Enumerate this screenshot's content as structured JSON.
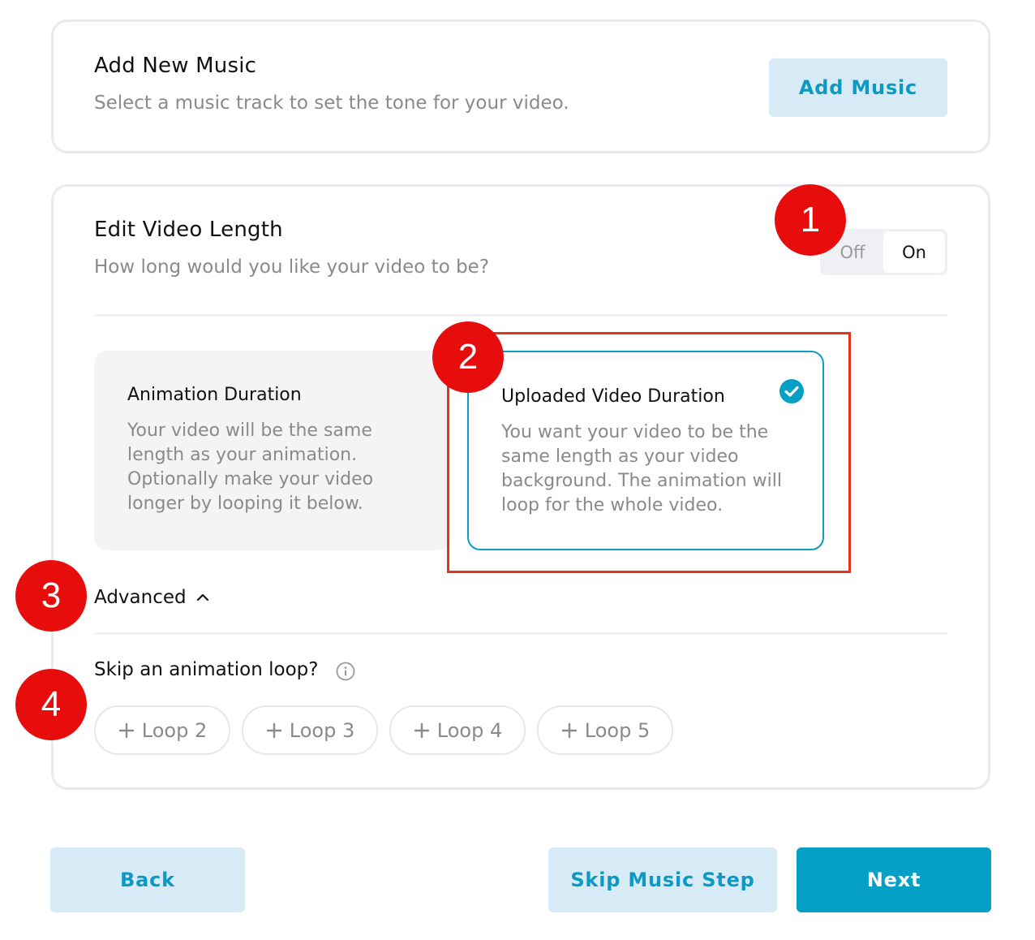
{
  "music": {
    "title": "Add New Music",
    "subtitle": "Select a music track to set the tone for your video.",
    "add_button": "Add Music"
  },
  "length": {
    "title": "Edit Video Length",
    "subtitle": "How long would you like your video to be?",
    "toggle": {
      "off_label": "Off",
      "on_label": "On",
      "selected": "On"
    },
    "options": [
      {
        "title": "Animation Duration",
        "description": "Your video will be the same length as your animation. Optionally make your video longer by looping it below.",
        "selected": false
      },
      {
        "title": "Uploaded Video Duration",
        "description": "You want your video to be the same length as your video background. The animation will loop for the whole video.",
        "selected": true
      }
    ],
    "advanced_label": "Advanced",
    "skip_label": "Skip an animation loop?",
    "loops": [
      "Loop 2",
      "Loop 3",
      "Loop 4",
      "Loop 5"
    ]
  },
  "markers": [
    "1",
    "2",
    "3",
    "4"
  ],
  "footer": {
    "back": "Back",
    "skip": "Skip Music Step",
    "next": "Next"
  },
  "colors": {
    "accent": "#05a0c6",
    "accent_light": "#d7ebf7",
    "highlight": "#e5321c",
    "marker": "#e70d0d"
  }
}
